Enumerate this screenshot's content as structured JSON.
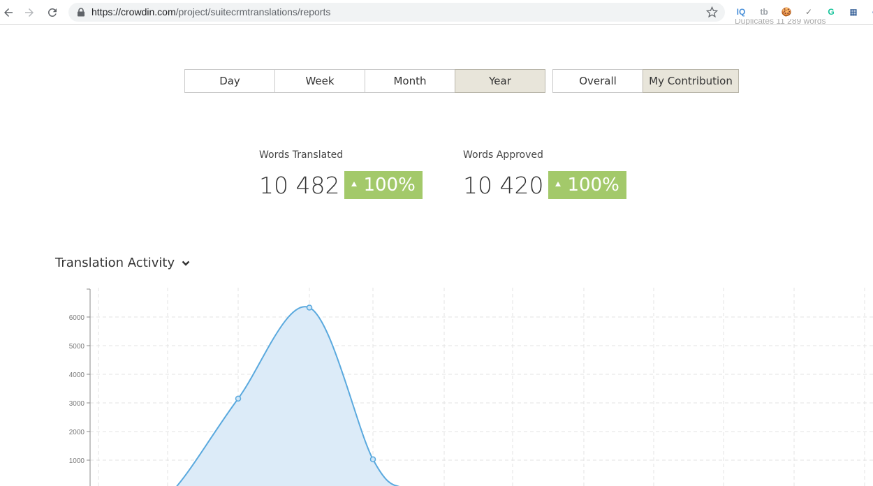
{
  "browser": {
    "url_host": "https://crowdin.com",
    "url_path": "/project/suitecrmtranslations/reports",
    "extensions": [
      {
        "name": "iq-icon",
        "label": "IQ",
        "color": "#4a90d9"
      },
      {
        "name": "tb-icon",
        "label": "tb",
        "color": "#9aa0a6"
      },
      {
        "name": "cookie-icon",
        "label": "🍪",
        "color": "#c8862a"
      },
      {
        "name": "check-icon",
        "label": "✓",
        "color": "#777777"
      },
      {
        "name": "grammarly-icon",
        "label": "G",
        "color": "#15c39a"
      },
      {
        "name": "board-icon",
        "label": "▦",
        "color": "#1f4e8c"
      },
      {
        "name": "globe-icon",
        "label": "●",
        "color": "#3b6fb6"
      }
    ]
  },
  "clipped_text": "Duplicates 11 289 words",
  "period_buttons": [
    {
      "label": "Day",
      "active": false
    },
    {
      "label": "Week",
      "active": false
    },
    {
      "label": "Month",
      "active": false
    },
    {
      "label": "Year",
      "active": true
    }
  ],
  "scope_buttons": [
    {
      "label": "Overall",
      "active": false
    },
    {
      "label": "My Contribution",
      "active": true
    }
  ],
  "stats": {
    "translated": {
      "label": "Words Translated",
      "value": "10 482",
      "change": "100%"
    },
    "approved": {
      "label": "Words Approved",
      "value": "10 420",
      "change": "100%"
    }
  },
  "section_title": "Translation Activity",
  "colors": {
    "accent_green": "#a3c96a",
    "line": "#5aa9de",
    "area": "#dcebf8",
    "grid": "#e3e3e3"
  },
  "chart_data": {
    "type": "area",
    "yticks": [
      1000,
      2000,
      3000,
      4000,
      5000,
      6000
    ],
    "ylim": [
      0,
      6600
    ],
    "x": [
      0,
      1,
      2,
      3,
      4
    ],
    "values": [
      0,
      3150,
      6330,
      1030,
      0
    ],
    "marked_points": [
      1,
      2,
      3
    ],
    "grid": true
  }
}
